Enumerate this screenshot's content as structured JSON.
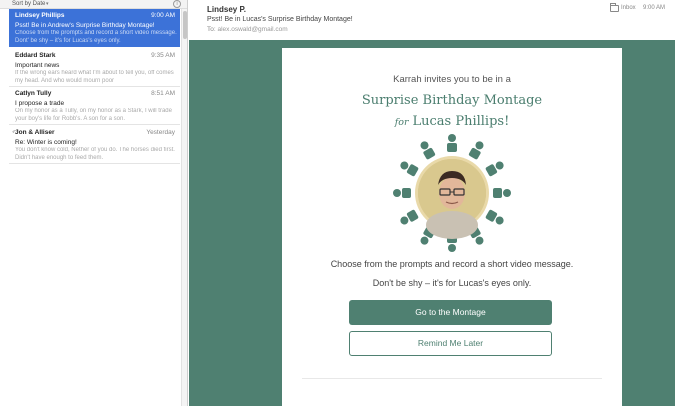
{
  "list": {
    "sort_label": "Sort by Date",
    "messages": [
      {
        "from": "Lindsey Phillips",
        "time": "9:00 AM",
        "subject": "Psst! Be in Andrew's Surprise Birthday Montage!",
        "preview": "Choose from the prompts and record a short video message. Dont' be shy – it's for Lucas's eyes only.",
        "selected": true
      },
      {
        "from": "Eddard Stark",
        "time": "9:35 AM",
        "subject": "Important news",
        "preview": "If the wrong ears heard what I'm about to tell you, off comes my head. And who would mourn poor"
      },
      {
        "from": "Catlyn Tully",
        "time": "8:51 AM",
        "subject": "I propose a trade",
        "preview": "On my honor as a Tully, on my honor as a Stark, I will trade your boy's life for Robb's. A son for a son."
      },
      {
        "from": "Jon & Alliser",
        "time": "Yesterday",
        "subject": "Re: Winter is coming!",
        "preview": "You don't know cold, Nether of you do. The horses died first. Didn't have enough to feed them."
      }
    ]
  },
  "reader": {
    "sender": "Lindsey P.",
    "subject": "Psst! Be in Lucas's Surprise Birthday Montage!",
    "to_label": "To:",
    "to_address": "alex.oswald@gmail.com",
    "folder": "Inbox",
    "time": "9:00 AM"
  },
  "card": {
    "invite": "Karrah invites you to be in a",
    "title_line1": "Surprise Birthday Montage",
    "for_word": "for",
    "title_name": "Lucas Phillips!",
    "desc1": "Choose from the prompts and record a short video message.",
    "desc2": "Don't be shy – it's for Lucas's eyes only.",
    "go_button": "Go to the Montage",
    "remind_button": "Remind Me Later"
  },
  "colors": {
    "accent_green": "#4f8071",
    "selection_blue": "#3c72d8"
  }
}
